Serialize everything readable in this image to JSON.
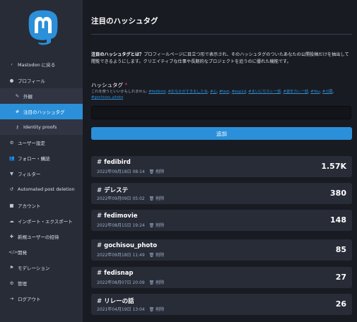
{
  "sidebar": {
    "items": [
      {
        "label": "Mastodon に戻る",
        "icon": "chevron-left-icon"
      },
      {
        "label": "プロフィール",
        "icon": "user-icon"
      },
      {
        "label": "外観",
        "icon": "pencil-icon"
      },
      {
        "label": "注目のハッシュタグ",
        "icon": "hashtag-icon"
      },
      {
        "label": "Identity proofs",
        "icon": "key-icon"
      },
      {
        "label": "ユーザー設定",
        "icon": "gear-icon"
      },
      {
        "label": "フォロー・購読",
        "icon": "users-icon"
      },
      {
        "label": "フィルター",
        "icon": "filter-icon"
      },
      {
        "label": "Automated post deletion",
        "icon": "history-icon"
      },
      {
        "label": "アカウント",
        "icon": "lock-icon"
      },
      {
        "label": "インポート・エクスポート",
        "icon": "cloud-download-icon"
      },
      {
        "label": "新規ユーザーの招待",
        "icon": "user-plus-icon"
      },
      {
        "label": "開発",
        "icon": "code-icon"
      },
      {
        "label": "モデレーション",
        "icon": "flag-icon"
      },
      {
        "label": "管理",
        "icon": "cogs-icon"
      },
      {
        "label": "ログアウト",
        "icon": "sign-out-icon"
      }
    ]
  },
  "main": {
    "title": "注目のハッシュタグ",
    "hint_bold": "注目のハッシュタグとは？",
    "hint_text": "プロフィールページに目立つ形で表示され、そのハッシュタグのついたあなたの公開投稿だけを抽出して閲覧できるようにします。クリエイティブな仕事や長期的なプロジェクトを追うのに優れた機能です。",
    "field_label": "ハッシュタグ",
    "field_required": "*",
    "field_hint_prefix": "これを使うといいかもしれません:",
    "suggestions": [
      "#fedibird",
      "#おなかがすきましたね",
      "#心",
      "#test",
      "#exp1d",
      "#まいにちカレー部",
      "#激辛カレー部",
      "#You",
      "#ガ蔵",
      "#gochisou_photo"
    ],
    "input_value": "",
    "input_placeholder": "",
    "add_button": "追加",
    "delete_label": "削除",
    "tags": [
      {
        "name": "fedibird",
        "date": "2022年09月18日 08:14",
        "count": "1.57K"
      },
      {
        "name": "デレステ",
        "date": "2022年09月09日 05:02",
        "count": "380"
      },
      {
        "name": "fedimovie",
        "date": "2022年08月15日 19:24",
        "count": "148"
      },
      {
        "name": "gochisou_photo",
        "date": "2022年09月18日 11:49",
        "count": "85"
      },
      {
        "name": "fedisnap",
        "date": "2022年08月07日 20:09",
        "count": "27"
      },
      {
        "name": "リレーの話",
        "date": "2021年04月19日 13:04",
        "count": "26"
      }
    ]
  },
  "colors": {
    "accent": "#2b90d9",
    "background": "#191b22",
    "sidebar": "#282c37",
    "required": "#df405a"
  }
}
